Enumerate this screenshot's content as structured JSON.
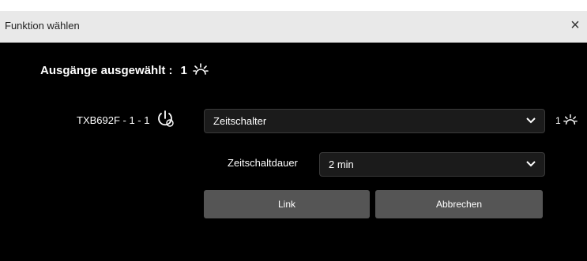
{
  "dialog": {
    "title": "Funktion wählen",
    "close_label": "×"
  },
  "selected": {
    "label": "Ausgänge ausgewählt :",
    "count": "1"
  },
  "device": {
    "name": "TXB692F - 1 - 1"
  },
  "function_select": {
    "value": "Zeitschalter"
  },
  "output_indicator": {
    "count": "1"
  },
  "duration": {
    "label": "Zeitschaltdauer",
    "value": "2 min"
  },
  "buttons": {
    "link": "Link",
    "cancel": "Abbrechen"
  },
  "icons": {
    "light": "light-bulb-rays-icon",
    "timer_power": "power-timer-icon",
    "chevron": "chevron-down-icon",
    "close": "close-icon"
  }
}
